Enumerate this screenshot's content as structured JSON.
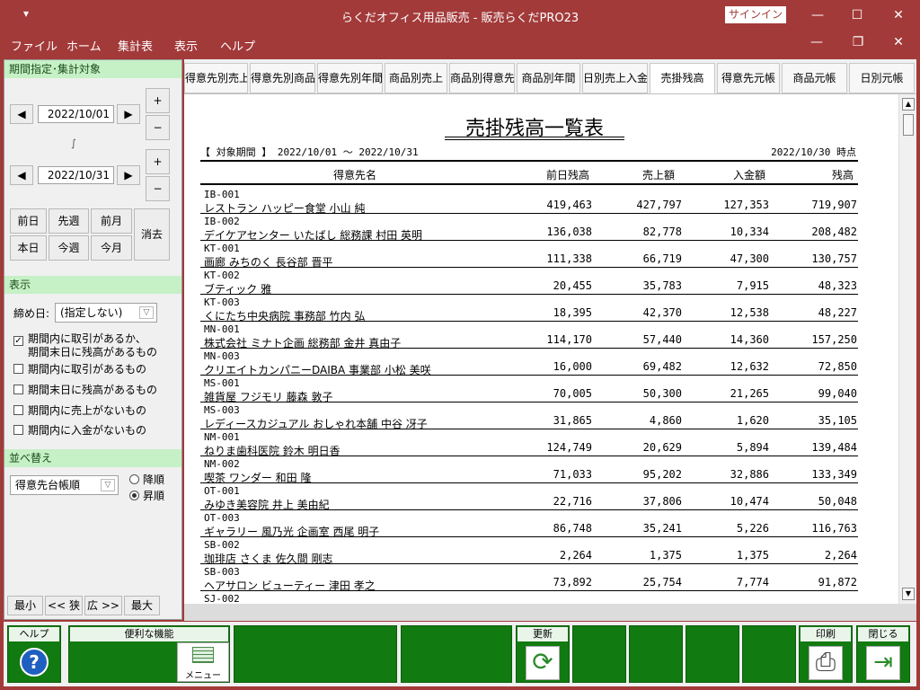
{
  "titlebar": {
    "quick_access": "▾",
    "title": "らくだオフィス用品販売  -  販売らくだPRO23",
    "signin": "サインイン",
    "minimize": "—",
    "maximize": "☐",
    "close": "✕"
  },
  "menubar": {
    "items": [
      "ファイル",
      "ホーム",
      "集計表",
      "表示",
      "ヘルプ"
    ],
    "minimize": "—",
    "restore": "❐",
    "close": "✕"
  },
  "left": {
    "period_header": "期間指定･集計対象",
    "start_date": "2022/10/01",
    "end_date": "2022/10/31",
    "tilde": "∫",
    "plus": "+",
    "minus": "−",
    "prev": "◀",
    "next": "▶",
    "quick": [
      "前日",
      "先週",
      "前月",
      "本日",
      "今週",
      "今月"
    ],
    "clear": "消去",
    "display_header": "表示",
    "closing_label": "締め日:",
    "closing_value": "(指定しない)",
    "options": [
      {
        "label": "期間内に取引があるか、",
        "label2": "期間末日に残高があるもの",
        "checked": true
      },
      {
        "label": "期間内に取引があるもの",
        "checked": false
      },
      {
        "label": "期間末日に残高があるもの",
        "checked": false
      },
      {
        "label": "期間内に売上がないもの",
        "checked": false
      },
      {
        "label": "期間内に入金がないもの",
        "checked": false
      }
    ],
    "check_mark": "✓",
    "sort_header": "並べ替え",
    "sort_value": "得意先台帳順",
    "desc": "降順",
    "asc": "昇順",
    "zoom": [
      "最小",
      "<< 狭",
      "広 >>",
      "最大"
    ]
  },
  "tabs": [
    "得意先別売上",
    "得意先別商品",
    "得意先別年間",
    "商品別売上",
    "商品別得意先",
    "商品別年間",
    "日別売上入金",
    "売掛残高",
    "得意先元帳",
    "商品元帳",
    "日別元帳"
  ],
  "report": {
    "title": "売掛残高一覧表",
    "period": "【 対象期間 】 2022/10/01 〜 2022/10/31",
    "as_of": "2022/10/30 時点",
    "headers": {
      "customer": "得意先名",
      "prev_balance": "前日残高",
      "sales": "売上額",
      "payment": "入金額",
      "balance": "残高"
    },
    "rows": [
      {
        "code": "IB-001",
        "name": "レストラン ハッピー食堂 小山 純",
        "prev": "419,463",
        "sales": "427,797",
        "pay": "127,353",
        "bal": "719,907"
      },
      {
        "code": "IB-002",
        "name": "デイケアセンター いたばし 総務課 村田 英明",
        "prev": "136,038",
        "sales": "82,778",
        "pay": "10,334",
        "bal": "208,482"
      },
      {
        "code": "KT-001",
        "name": "画廊 みちのく 長谷部 晋平",
        "prev": "111,338",
        "sales": "66,719",
        "pay": "47,300",
        "bal": "130,757"
      },
      {
        "code": "KT-002",
        "name": "ブティック 雅",
        "prev": "20,455",
        "sales": "35,783",
        "pay": "7,915",
        "bal": "48,323"
      },
      {
        "code": "KT-003",
        "name": "くにたち中央病院 事務部 竹内 弘",
        "prev": "18,395",
        "sales": "42,370",
        "pay": "12,538",
        "bal": "48,227"
      },
      {
        "code": "MN-001",
        "name": "株式会社 ミナト企画 総務部 金井 真由子",
        "prev": "114,170",
        "sales": "57,440",
        "pay": "14,360",
        "bal": "157,250"
      },
      {
        "code": "MN-003",
        "name": "クリエイトカンパニーDAIBA 事業部 小松 美咲",
        "prev": "16,000",
        "sales": "69,482",
        "pay": "12,632",
        "bal": "72,850"
      },
      {
        "code": "MS-001",
        "name": "雑貨屋 フジモリ 藤森 敦子",
        "prev": "70,005",
        "sales": "50,300",
        "pay": "21,265",
        "bal": "99,040"
      },
      {
        "code": "MS-003",
        "name": "レディースカジュアル おしゃれ本舗 中谷 冴子",
        "prev": "31,865",
        "sales": "4,860",
        "pay": "1,620",
        "bal": "35,105"
      },
      {
        "code": "NM-001",
        "name": "ねりま歯科医院 鈴木 明日香",
        "prev": "124,749",
        "sales": "20,629",
        "pay": "5,894",
        "bal": "139,484"
      },
      {
        "code": "NM-002",
        "name": "喫茶 ワンダー 和田 隆",
        "prev": "71,033",
        "sales": "95,202",
        "pay": "32,886",
        "bal": "133,349"
      },
      {
        "code": "OT-001",
        "name": "みゆき美容院 井上 美由紀",
        "prev": "22,716",
        "sales": "37,806",
        "pay": "10,474",
        "bal": "50,048"
      },
      {
        "code": "OT-003",
        "name": "ギャラリー 風乃光 企画室 西尾 明子",
        "prev": "86,748",
        "sales": "35,241",
        "pay": "5,226",
        "bal": "116,763"
      },
      {
        "code": "SB-002",
        "name": "珈琲店 さくま 佐久間 剛志",
        "prev": "2,264",
        "sales": "1,375",
        "pay": "1,375",
        "bal": "2,264"
      },
      {
        "code": "SB-003",
        "name": "ヘアサロン ビューティー 津田 孝之",
        "prev": "73,892",
        "sales": "25,754",
        "pay": "7,774",
        "bal": "91,872"
      },
      {
        "code": "SJ-002",
        "name": "",
        "prev": "",
        "sales": "",
        "pay": "",
        "bal": ""
      }
    ]
  },
  "scroll": {
    "up": "▲",
    "down": "▼"
  },
  "bottom": {
    "help": "ヘルプ",
    "help_glyph": "?",
    "convenient": "便利な機能",
    "menu": "メニュー",
    "refresh": "更新",
    "refresh_glyph": "⟳",
    "print": "印刷",
    "print_glyph": "⎙",
    "close": "閉じる",
    "close_glyph": "⇥"
  }
}
